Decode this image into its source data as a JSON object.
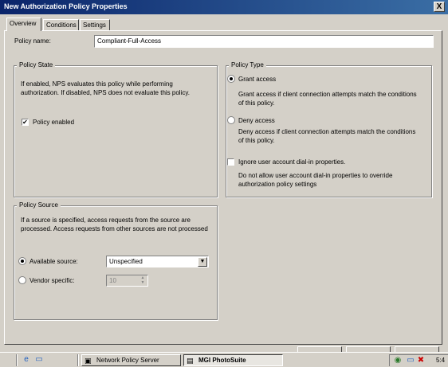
{
  "window": {
    "title": "New Authorization Policy Properties",
    "close_glyph": "X"
  },
  "tabs": [
    {
      "label": "Overview",
      "active": true
    },
    {
      "label": "Conditions",
      "active": false
    },
    {
      "label": "Settings",
      "active": false
    }
  ],
  "overview": {
    "policy_name_label": "Policy name:",
    "policy_name_value": "Compliant-Full-Access",
    "policy_state": {
      "legend": "Policy State",
      "description_line1": "If enabled, NPS evaluates this policy while performing",
      "description_line2": "authorization. If disabled, NPS does not evaluate this policy.",
      "enabled_label": "Policy enabled",
      "enabled_checked": true
    },
    "policy_type": {
      "legend": "Policy Type",
      "grant_label": "Grant access",
      "grant_selected": true,
      "grant_desc_line1": "Grant access if client connection attempts match the conditions",
      "grant_desc_line2": "of this policy.",
      "deny_label": "Deny access",
      "deny_selected": false,
      "deny_desc_line1": "Deny access if client connection attempts match the conditions",
      "deny_desc_line2": "of this policy.",
      "ignore_label": "Ignore user account dial-in properties.",
      "ignore_checked": false,
      "ignore_desc_line1": "Do not allow user account dial-in properties to override",
      "ignore_desc_line2": "authorization policy settings"
    },
    "policy_source": {
      "legend": "Policy Source",
      "description_line1": "If a source is specified, access requests from the source are",
      "description_line2": "processed. Access requests from other sources are not processed",
      "available_label": "Available source:",
      "available_selected": true,
      "available_value": "Unspecified",
      "vendor_label": "Vendor specific:",
      "vendor_selected": false,
      "vendor_value": "10"
    }
  },
  "taskbar": {
    "quick_launch_icons": [
      "ie-icon",
      "desktop-icon"
    ],
    "buttons": [
      {
        "label": "Network Policy Server",
        "pressed": false
      },
      {
        "label": "MGI PhotoSuite",
        "pressed": true
      }
    ],
    "clock": "5:4"
  }
}
